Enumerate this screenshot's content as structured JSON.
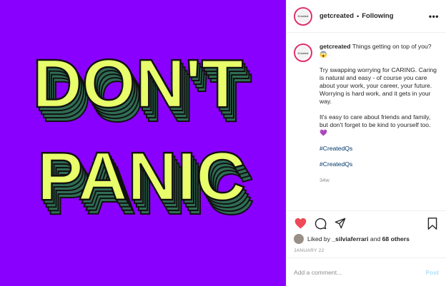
{
  "image": {
    "background_color": "#8a00ff",
    "text_color": "#e8ff6b",
    "shadow_color": "#2e6e54",
    "line1": "DON'T",
    "line2": "PANIC"
  },
  "header": {
    "username": "getcreated",
    "separator": "•",
    "follow_status": "Following",
    "avatar_text": "Created",
    "more_icon": "more-horizontal-icon"
  },
  "caption": {
    "username": "getcreated",
    "first_line": "Things getting on top of you? 😱",
    "para1": "Try swapping worrying for CARING. Caring is natural and easy - of course you care about your work, your career, your future. Worrying is hard work, and it gets in your way.",
    "para2": "It's easy to care about friends and family, but don't forget to be kind to yourself too. 💜",
    "hashtag1": "#CreatedQs",
    "hashtag2": "#CreatedQs",
    "time_ago": "34w"
  },
  "actions": {
    "like_icon": "heart-filled-icon",
    "comment_icon": "comment-icon",
    "share_icon": "share-icon",
    "save_icon": "bookmark-icon",
    "like_color": "#ed4956"
  },
  "likes": {
    "prefix": "Liked by",
    "user": "_silviaferrari",
    "connector": "and",
    "others": "68 others"
  },
  "date": "JANUARY 22",
  "comment": {
    "placeholder": "Add a comment...",
    "post_label": "Post"
  }
}
